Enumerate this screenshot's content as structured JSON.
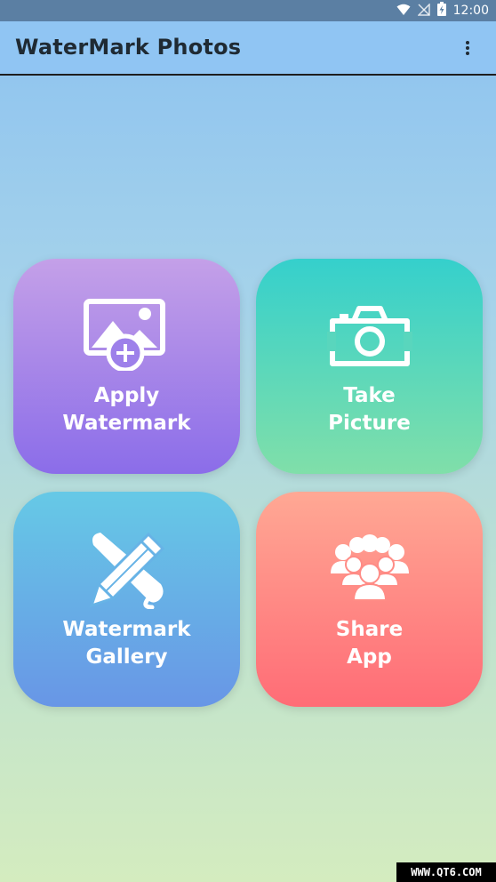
{
  "status_bar": {
    "time": "12:00"
  },
  "app_bar": {
    "title": "WaterMark Photos"
  },
  "tiles": [
    {
      "line1": "Apply",
      "line2": "Watermark",
      "icon": "add-image-icon",
      "gradient": [
        "#c4a0e8",
        "#8b6de9"
      ]
    },
    {
      "line1": "Take",
      "line2": "Picture",
      "icon": "camera-icon",
      "gradient": [
        "#35d0cc",
        "#80dfa9"
      ]
    },
    {
      "line1": "Watermark",
      "line2": "Gallery",
      "icon": "pencil-brush-icon",
      "gradient": [
        "#66c9e6",
        "#6896e6"
      ]
    },
    {
      "line1": "Share",
      "line2": "App",
      "icon": "people-group-icon",
      "gradient": [
        "#ffa894",
        "#ff6c76"
      ]
    }
  ],
  "watermark": {
    "text": "WWW.QT6.COM"
  },
  "colors": {
    "status_bar": "#5b7fa3",
    "app_bar": "#90c5f3",
    "title_text": "#1f2a33"
  }
}
